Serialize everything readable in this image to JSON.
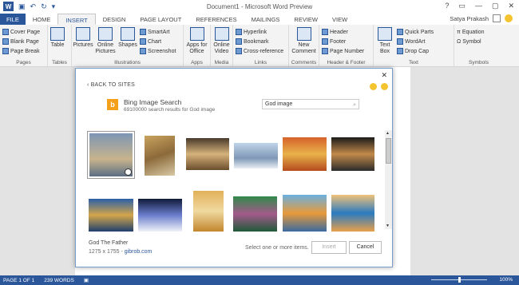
{
  "window": {
    "title": "Document1 - Microsoft Word Preview",
    "user": "Satya Prakash",
    "controls": [
      "?",
      "▭",
      "—",
      "▢",
      "✕"
    ]
  },
  "tabs": [
    "FILE",
    "HOME",
    "INSERT",
    "DESIGN",
    "PAGE LAYOUT",
    "REFERENCES",
    "MAILINGS",
    "REVIEW",
    "VIEW"
  ],
  "ribbon": {
    "pages": {
      "label": "Pages",
      "items": [
        "Cover Page",
        "Blank Page",
        "Page Break"
      ]
    },
    "tables": {
      "label": "Tables",
      "big": "Table"
    },
    "illustrations": {
      "label": "Illustrations",
      "pictures": "Pictures",
      "online": "Online Pictures",
      "shapes": "Shapes",
      "smartart": "SmartArt",
      "chart": "Chart",
      "screenshot": "Screenshot"
    },
    "apps": {
      "label": "Apps",
      "big": "Apps for Office"
    },
    "media": {
      "label": "Media",
      "big": "Online Video"
    },
    "links": {
      "label": "Links",
      "items": [
        "Hyperlink",
        "Bookmark",
        "Cross-reference"
      ]
    },
    "comments": {
      "label": "Comments",
      "big": "New Comment"
    },
    "headerfooter": {
      "label": "Header & Footer",
      "items": [
        "Header",
        "Footer",
        "Page Number"
      ]
    },
    "text": {
      "label": "Text",
      "textbox": "Text Box",
      "items": [
        "Quick Parts",
        "WordArt",
        "Drop Cap"
      ]
    },
    "symbols": {
      "label": "Symbols",
      "items": [
        "Equation",
        "Symbol"
      ]
    }
  },
  "dialog": {
    "back": "BACK TO SITES",
    "source": "Bing Image Search",
    "result_count": "69100000 search results for God image",
    "query": "God image",
    "selected_title": "God The Father",
    "selected_dims": "1275 x 1755 - ",
    "selected_source": "gibrob.com",
    "hint": "Select one or more items.",
    "insert": "Insert",
    "cancel": "Cancel"
  },
  "status": {
    "page": "PAGE 1 OF 1",
    "words": "239 WORDS",
    "zoom": "100%"
  },
  "colors": {
    "accent": "#2b579a",
    "bing": "#f5a01a"
  }
}
